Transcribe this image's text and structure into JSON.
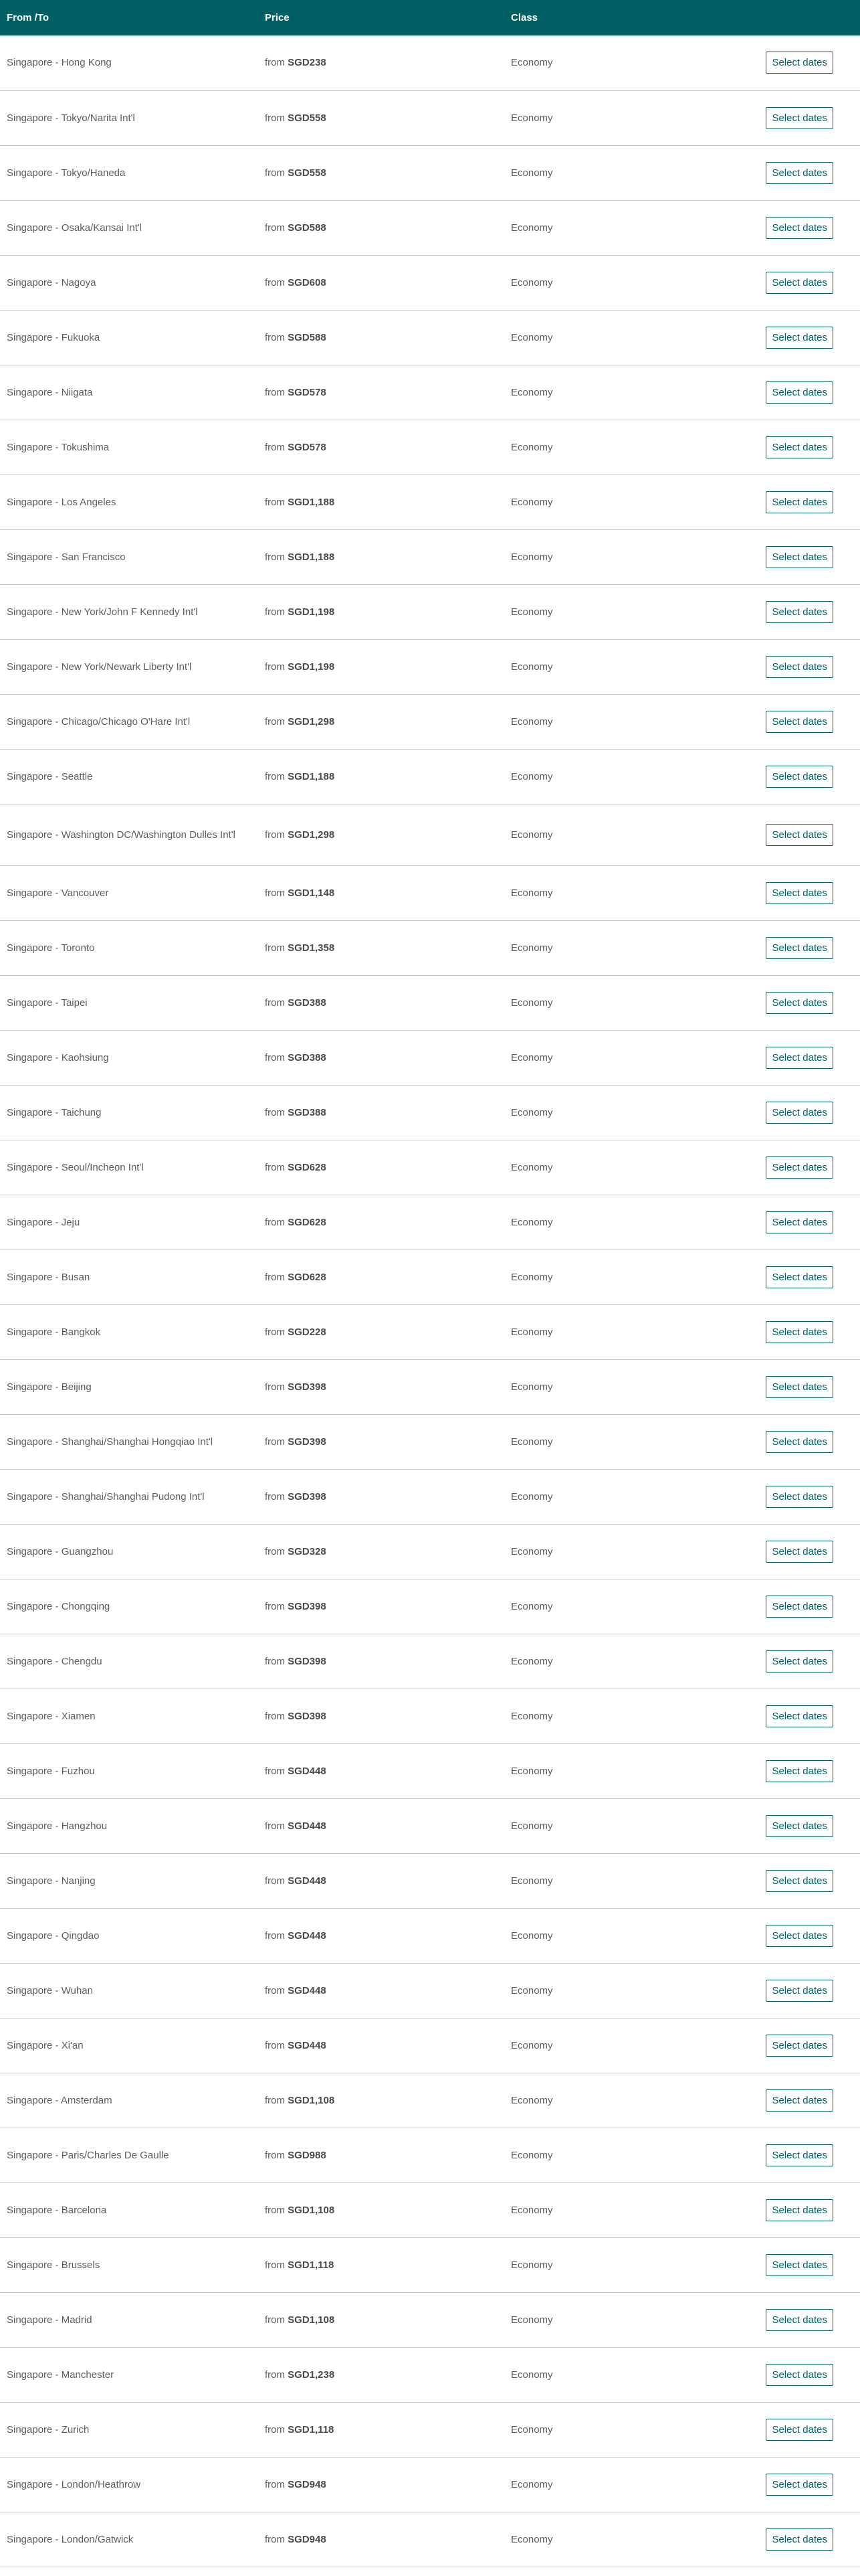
{
  "header": {
    "from_to": "From /To",
    "price": "Price",
    "class": "Class"
  },
  "price_prefix": "from",
  "select_label": "Select dates",
  "rows": [
    {
      "route": "Singapore - Hong Kong",
      "price": "SGD238",
      "class": "Economy"
    },
    {
      "route": "Singapore - Tokyo/Narita Int'l",
      "price": "SGD558",
      "class": "Economy"
    },
    {
      "route": "Singapore - Tokyo/Haneda",
      "price": "SGD558",
      "class": "Economy"
    },
    {
      "route": "Singapore - Osaka/Kansai Int'l",
      "price": "SGD588",
      "class": "Economy"
    },
    {
      "route": "Singapore - Nagoya",
      "price": "SGD608",
      "class": "Economy"
    },
    {
      "route": "Singapore - Fukuoka",
      "price": "SGD588",
      "class": "Economy"
    },
    {
      "route": "Singapore - Niigata",
      "price": "SGD578",
      "class": "Economy"
    },
    {
      "route": "Singapore - Tokushima",
      "price": "SGD578",
      "class": "Economy"
    },
    {
      "route": "Singapore - Los Angeles",
      "price": "SGD1,188",
      "class": "Economy"
    },
    {
      "route": "Singapore - San Francisco",
      "price": "SGD1,188",
      "class": "Economy"
    },
    {
      "route": "Singapore - New York/John F Kennedy Int'l",
      "price": "SGD1,198",
      "class": "Economy"
    },
    {
      "route": "Singapore - New York/Newark Liberty Int'l",
      "price": "SGD1,198",
      "class": "Economy"
    },
    {
      "route": "Singapore - Chicago/Chicago O'Hare Int'l",
      "price": "SGD1,298",
      "class": "Economy"
    },
    {
      "route": "Singapore - Seattle",
      "price": "SGD1,188",
      "class": "Economy"
    },
    {
      "route": "Singapore - Washington DC/Washington Dulles Int'l",
      "price": "SGD1,298",
      "class": "Economy"
    },
    {
      "route": "Singapore - Vancouver",
      "price": "SGD1,148",
      "class": "Economy"
    },
    {
      "route": "Singapore - Toronto",
      "price": "SGD1,358",
      "class": "Economy"
    },
    {
      "route": "Singapore - Taipei",
      "price": "SGD388",
      "class": "Economy"
    },
    {
      "route": "Singapore - Kaohsiung",
      "price": "SGD388",
      "class": "Economy"
    },
    {
      "route": "Singapore - Taichung",
      "price": "SGD388",
      "class": "Economy"
    },
    {
      "route": "Singapore - Seoul/Incheon Int'l",
      "price": "SGD628",
      "class": "Economy"
    },
    {
      "route": "Singapore - Jeju",
      "price": "SGD628",
      "class": "Economy"
    },
    {
      "route": "Singapore - Busan",
      "price": "SGD628",
      "class": "Economy"
    },
    {
      "route": "Singapore - Bangkok",
      "price": "SGD228",
      "class": "Economy"
    },
    {
      "route": "Singapore - Beijing",
      "price": "SGD398",
      "class": "Economy"
    },
    {
      "route": "Singapore - Shanghai/Shanghai Hongqiao Int'l",
      "price": "SGD398",
      "class": "Economy"
    },
    {
      "route": "Singapore - Shanghai/Shanghai Pudong Int'l",
      "price": "SGD398",
      "class": "Economy"
    },
    {
      "route": "Singapore - Guangzhou",
      "price": "SGD328",
      "class": "Economy"
    },
    {
      "route": "Singapore - Chongqing",
      "price": "SGD398",
      "class": "Economy"
    },
    {
      "route": "Singapore - Chengdu",
      "price": "SGD398",
      "class": "Economy"
    },
    {
      "route": "Singapore - Xiamen",
      "price": "SGD398",
      "class": "Economy"
    },
    {
      "route": "Singapore - Fuzhou",
      "price": "SGD448",
      "class": "Economy"
    },
    {
      "route": "Singapore - Hangzhou",
      "price": "SGD448",
      "class": "Economy"
    },
    {
      "route": "Singapore - Nanjing",
      "price": "SGD448",
      "class": "Economy"
    },
    {
      "route": "Singapore - Qingdao",
      "price": "SGD448",
      "class": "Economy"
    },
    {
      "route": "Singapore - Wuhan",
      "price": "SGD448",
      "class": "Economy"
    },
    {
      "route": "Singapore - Xi'an",
      "price": "SGD448",
      "class": "Economy"
    },
    {
      "route": "Singapore - Amsterdam",
      "price": "SGD1,108",
      "class": "Economy"
    },
    {
      "route": "Singapore - Paris/Charles De Gaulle",
      "price": "SGD988",
      "class": "Economy"
    },
    {
      "route": "Singapore - Barcelona",
      "price": "SGD1,108",
      "class": "Economy"
    },
    {
      "route": "Singapore - Brussels",
      "price": "SGD1,118",
      "class": "Economy"
    },
    {
      "route": "Singapore - Madrid",
      "price": "SGD1,108",
      "class": "Economy"
    },
    {
      "route": "Singapore - Manchester",
      "price": "SGD1,238",
      "class": "Economy"
    },
    {
      "route": "Singapore - Zurich",
      "price": "SGD1,118",
      "class": "Economy"
    },
    {
      "route": "Singapore - London/Heathrow",
      "price": "SGD948",
      "class": "Economy"
    },
    {
      "route": "Singapore - London/Gatwick",
      "price": "SGD948",
      "class": "Economy"
    }
  ],
  "colors": {
    "header_bg": "#005f62",
    "accent": "#005f62",
    "divider": "#c9c9c9"
  }
}
